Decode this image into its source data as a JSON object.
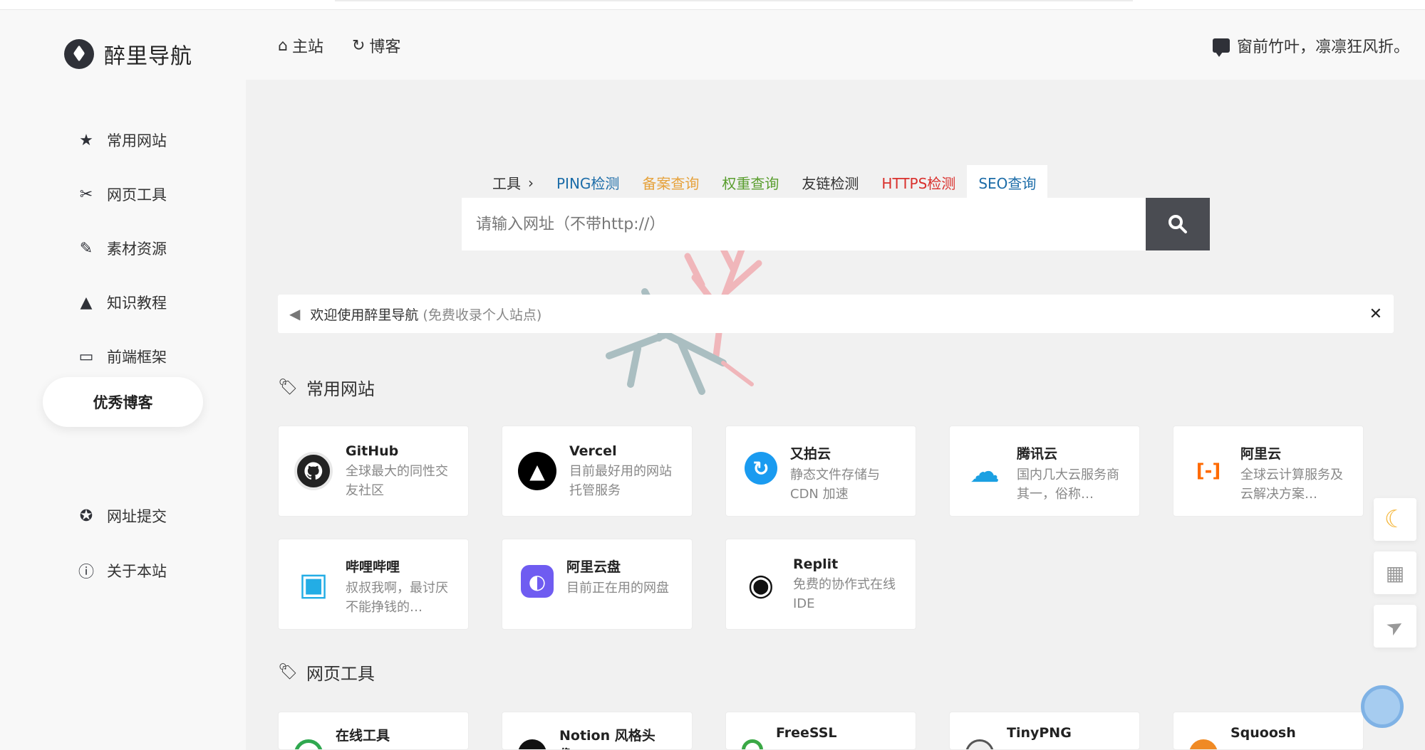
{
  "brand": {
    "title": "醉里导航"
  },
  "sidebar": {
    "items": [
      {
        "label": "常用网站",
        "icon": "star-icon"
      },
      {
        "label": "网页工具",
        "icon": "tools-icon"
      },
      {
        "label": "素材资源",
        "icon": "pen-icon"
      },
      {
        "label": "知识教程",
        "icon": "graduation-cap-icon"
      },
      {
        "label": "前端框架",
        "icon": "laptop-icon"
      },
      {
        "label": "优秀博客",
        "icon": "",
        "active": true
      },
      {
        "label": "网址提交",
        "icon": "award-icon"
      },
      {
        "label": "关于本站",
        "icon": "info-icon"
      }
    ]
  },
  "header": {
    "nav": [
      {
        "label": "主站",
        "icon": "home-icon"
      },
      {
        "label": "博客",
        "icon": "blog-icon"
      }
    ],
    "quote": "窗前竹叶，凛凛狂风折。"
  },
  "search": {
    "tabs_label": "工具",
    "tabs": [
      {
        "label": "PING检测",
        "color": "#1b6ca8"
      },
      {
        "label": "备案查询",
        "color": "#e6a23c"
      },
      {
        "label": "权重查询",
        "color": "#5a9e2f"
      },
      {
        "label": "友链检测",
        "color": "#333333"
      },
      {
        "label": "HTTPS检测",
        "color": "#d9302c"
      },
      {
        "label": "SEO查询",
        "color": "#1b6ca8",
        "active": true
      }
    ],
    "placeholder": "请输入网址（不带http://）"
  },
  "notice": {
    "text": "欢迎使用醉里导航",
    "sub": "(免费收录个人站点)",
    "close": "✕"
  },
  "sections": [
    {
      "title": "常用网站",
      "cards": [
        {
          "name": "GitHub",
          "desc": "全球最大的同性交友社区",
          "icon": "github-icon",
          "color": "#222222",
          "glyph": ""
        },
        {
          "name": "Vercel",
          "desc": "目前最好用的网站托管服务",
          "icon": "vercel-icon",
          "color": "#000000",
          "glyph": "▲"
        },
        {
          "name": "又拍云",
          "desc": "静态文件存储与 CDN 加速",
          "icon": "upyun-icon",
          "color": "#1a9bf0",
          "glyph": "↻"
        },
        {
          "name": "腾讯云",
          "desc": "国内几大云服务商其一，俗称…",
          "icon": "tencent-cloud-icon",
          "color": "#1ba0e2",
          "glyph": "☁"
        },
        {
          "name": "阿里云",
          "desc": "全球云计算服务及云解决方案…",
          "icon": "aliyun-icon",
          "color": "#ff6a00",
          "glyph": "[-]"
        },
        {
          "name": "哔哩哔哩",
          "desc": "叔叔我啊，最讨厌不能挣钱的…",
          "icon": "bilibili-icon",
          "color": "#23ade5",
          "glyph": "▣"
        },
        {
          "name": "阿里云盘",
          "desc": "目前正在用的网盘",
          "icon": "aliyun-drive-icon",
          "color": "#6f5cf1",
          "glyph": "◐"
        },
        {
          "name": "Replit",
          "desc": "免费的协作式在线 IDE",
          "icon": "replit-icon",
          "color": "#111111",
          "glyph": "◉"
        }
      ]
    },
    {
      "title": "网页工具",
      "cards": [
        {
          "name": "在线工具",
          "desc": "",
          "icon": "online-tools-icon",
          "color": "#2fa84f",
          "glyph": ""
        },
        {
          "name": "Notion 风格头像…",
          "desc": "",
          "icon": "notion-avatar-icon",
          "color": "#111111",
          "glyph": ""
        },
        {
          "name": "FreeSSL",
          "desc": "",
          "icon": "freessl-icon",
          "color": "#3aa845",
          "glyph": ""
        },
        {
          "name": "TinyPNG",
          "desc": "",
          "icon": "tinypng-icon",
          "color": "#555555",
          "glyph": ""
        },
        {
          "name": "Squoosh",
          "desc": "",
          "icon": "squoosh-icon",
          "color": "#f08a24",
          "glyph": ""
        }
      ]
    }
  ],
  "floats": [
    {
      "icon": "moon-icon",
      "glyph": "☾",
      "color": "#f5b942"
    },
    {
      "icon": "grid-icon",
      "glyph": "▦",
      "color": "#aaaaaa"
    },
    {
      "icon": "send-icon",
      "glyph": "➤",
      "color": "#aaaaaa"
    }
  ]
}
